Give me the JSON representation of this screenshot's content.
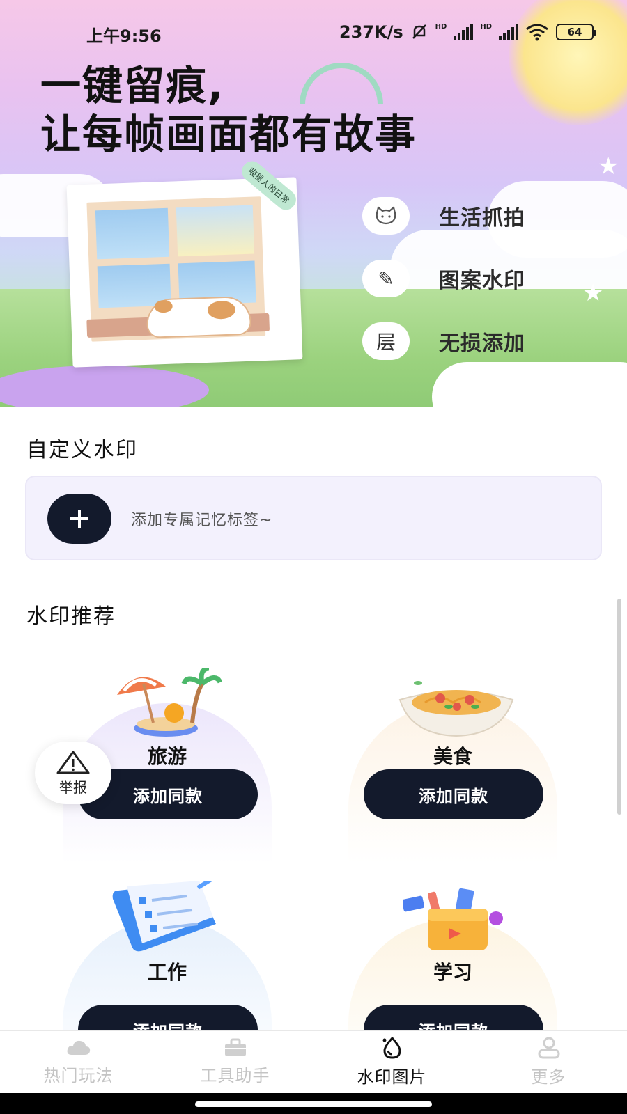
{
  "status_bar": {
    "time": "上午9:56",
    "net_speed": "237K/s",
    "hd1": "HD",
    "hd2": "HD",
    "battery": "64"
  },
  "hero": {
    "title_line1": "一键留痕,",
    "title_line2": "让每帧画面都有故事",
    "photo_tag": "喵星人的日常",
    "features": [
      {
        "label": "生活抓拍",
        "icon": "cat-face-icon"
      },
      {
        "label": "图案水印",
        "icon": "pen-icon",
        "glyph": "✎"
      },
      {
        "label": "无损添加",
        "icon": "layer-char-icon",
        "glyph": "层"
      }
    ]
  },
  "custom": {
    "title": "自定义水印",
    "add_text": "添加专属记忆标签~"
  },
  "recommend": {
    "title": "水印推荐",
    "items": [
      {
        "label": "旅游",
        "button": "添加同款",
        "icon": "beach-island-icon",
        "bg": "#ece6fb"
      },
      {
        "label": "美食",
        "button": "添加同款",
        "icon": "pasta-bowl-icon",
        "bg": "#fdf3e6"
      },
      {
        "label": "工作",
        "button": "添加同款",
        "icon": "checklist-scroll-icon",
        "bg": "#e6f0fc"
      },
      {
        "label": "学习",
        "button": "添加同款",
        "icon": "stationery-box-icon",
        "bg": "#fdf4e2"
      }
    ]
  },
  "report": {
    "label": "举报"
  },
  "bottom_nav": {
    "items": [
      {
        "label": "热门玩法",
        "icon": "cloud-icon",
        "active": false
      },
      {
        "label": "工具助手",
        "icon": "toolbox-icon",
        "active": false
      },
      {
        "label": "水印图片",
        "icon": "water-drop-icon",
        "active": true
      },
      {
        "label": "更多",
        "icon": "user-icon",
        "active": false
      }
    ]
  },
  "colors": {
    "primary_button": "#131a2c",
    "nav_inactive": "#c4c4c4",
    "nav_active": "#111111"
  }
}
